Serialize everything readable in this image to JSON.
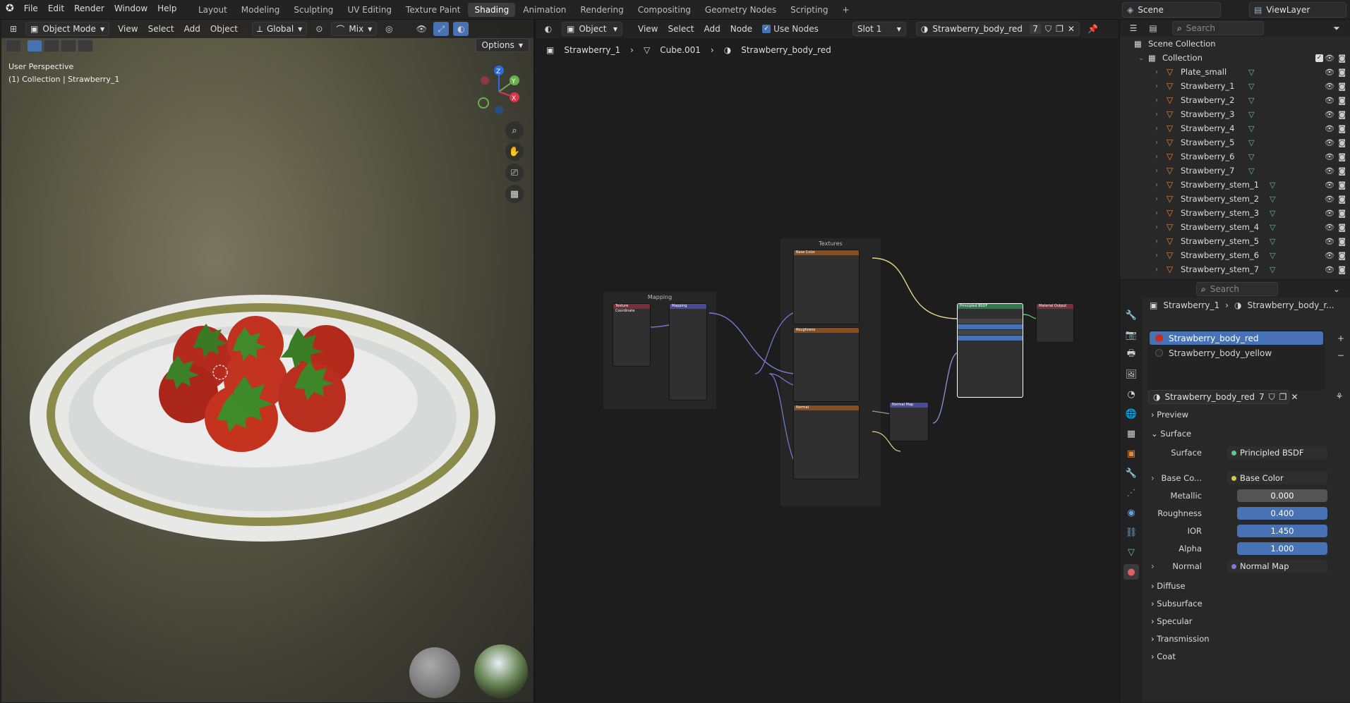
{
  "topbar": {
    "menus": [
      "File",
      "Edit",
      "Render",
      "Window",
      "Help"
    ],
    "workspaces": [
      "Layout",
      "Modeling",
      "Sculpting",
      "UV Editing",
      "Texture Paint",
      "Shading",
      "Animation",
      "Rendering",
      "Compositing",
      "Geometry Nodes",
      "Scripting"
    ],
    "active_workspace": "Shading",
    "add_tab": "+",
    "scene": "Scene",
    "view_layer": "ViewLayer"
  },
  "viewport": {
    "mode": "Object Mode",
    "menus": [
      "View",
      "Select",
      "Add",
      "Object"
    ],
    "orientation": "Global",
    "snap": "Mix",
    "options_label": "Options",
    "info_line1": "User Perspective",
    "info_line2": "(1) Collection | Strawberry_1",
    "gizmo_z": "Z",
    "gizmo_y": "Y",
    "gizmo_x": "X"
  },
  "node_editor": {
    "object_dropdown": "Object",
    "menus": [
      "View",
      "Select",
      "Add",
      "Node"
    ],
    "use_nodes_label": "Use Nodes",
    "slot": "Slot 1",
    "material_name": "Strawberry_body_red",
    "user_count": "7",
    "breadcrumb": [
      "Strawberry_1",
      "Cube.001",
      "Strawberry_body_red"
    ],
    "frames": {
      "textures": "Textures",
      "mapping": "Mapping"
    },
    "nodes": {
      "texture_coordinate": "Texture Coordinate",
      "mapping": "Mapping",
      "base_color": "Base Color",
      "roughness": "Roughness",
      "normal": "Normal",
      "normal_map": "Normal Map",
      "principled": "Principled BSDF",
      "material_output": "Material Output"
    }
  },
  "outliner": {
    "search_placeholder": "Search",
    "scene_collection": "Scene Collection",
    "collection": "Collection",
    "items": [
      "Plate_small",
      "Strawberry_1",
      "Strawberry_2",
      "Strawberry_3",
      "Strawberry_4",
      "Strawberry_5",
      "Strawberry_6",
      "Strawberry_7",
      "Strawberry_stem_1",
      "Strawberry_stem_2",
      "Strawberry_stem_3",
      "Strawberry_stem_4",
      "Strawberry_stem_5",
      "Strawberry_stem_6",
      "Strawberry_stem_7"
    ]
  },
  "properties": {
    "search_placeholder": "Search",
    "path_object": "Strawberry_1",
    "path_material": "Strawberry_body_r...",
    "slots": [
      "Strawberry_body_red",
      "Strawberry_body_yellow"
    ],
    "material_name": "Strawberry_body_red",
    "user_count": "7",
    "panels": {
      "preview": "Preview",
      "surface": "Surface",
      "diffuse": "Diffuse",
      "subsurface": "Subsurface",
      "specular": "Specular",
      "transmission": "Transmission",
      "coat": "Coat"
    },
    "surface": {
      "surface_label": "Surface",
      "surface_value": "Principled BSDF",
      "base_color_label": "Base Co...",
      "base_color_value": "Base Color",
      "metallic_label": "Metallic",
      "metallic_value": "0.000",
      "roughness_label": "Roughness",
      "roughness_value": "0.400",
      "ior_label": "IOR",
      "ior_value": "1.450",
      "alpha_label": "Alpha",
      "alpha_value": "1.000",
      "normal_label": "Normal",
      "normal_value": "Normal Map"
    }
  },
  "colors": {
    "accent_blue": "#4772b3",
    "object_orange": "#e08a3c",
    "mesh_green": "#5ec98a"
  }
}
